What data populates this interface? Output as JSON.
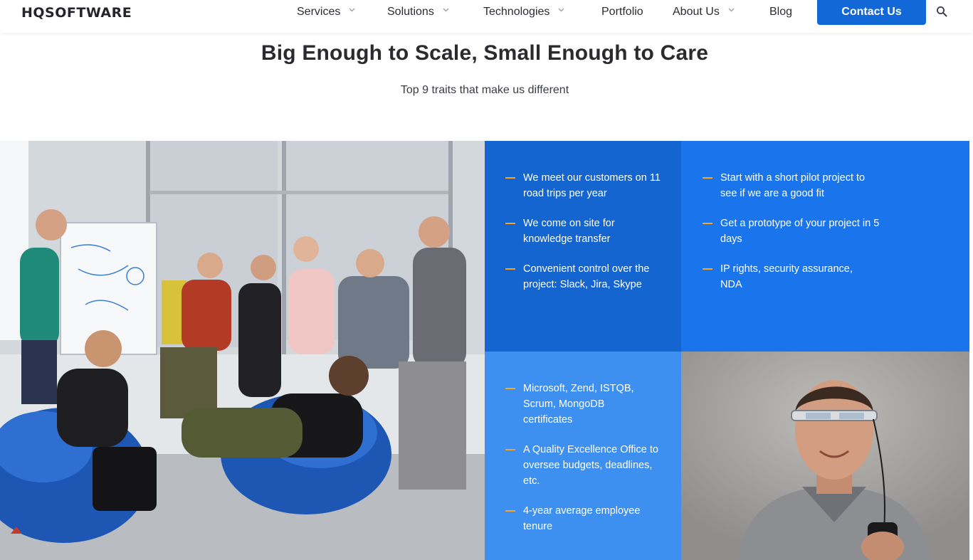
{
  "header": {
    "logo": "HQSOFTWARE",
    "nav": [
      {
        "label": "Services",
        "has_dropdown": true
      },
      {
        "label": "Solutions",
        "has_dropdown": true
      },
      {
        "label": "Technologies",
        "has_dropdown": true
      },
      {
        "label": "Portfolio",
        "has_dropdown": false
      },
      {
        "label": "About Us",
        "has_dropdown": true
      },
      {
        "label": "Blog",
        "has_dropdown": false
      }
    ],
    "cta": "Contact Us",
    "search_icon": "search-icon"
  },
  "section": {
    "title": "Big Enough to Scale, Small Enough to Care",
    "subtitle": "Top 9 traits that make us different"
  },
  "panels": [
    {
      "color": "#1565d0",
      "traits": [
        "We meet our customers on 11 road trips per year",
        "We come on site for knowledge transfer",
        "Convenient control over the project: Slack, Jira, Skype"
      ]
    },
    {
      "color": "#1a74eb",
      "traits": [
        "Start with a short pilot project to see if we are a good fit",
        "Get a prototype of your project in 5 days",
        "IP rights, security assurance, NDA"
      ]
    },
    {
      "color": "#3d8ff0",
      "traits": [
        "Microsoft, Zend, ISTQB, Scrum, MongoDB certificates",
        "A Quality Excellence Office to oversee budgets, deadlines, etc.",
        "4-year average employee tenure"
      ]
    }
  ],
  "colors": {
    "accent": "#1368d8",
    "dash": "#f5a623",
    "heading": "#2b2b2f"
  }
}
